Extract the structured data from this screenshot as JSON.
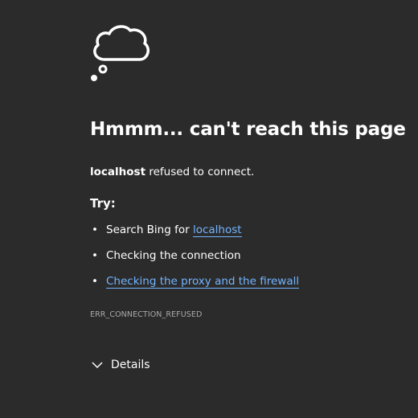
{
  "error_page": {
    "heading": "Hmmm... can't reach this page",
    "message_host": "localhost",
    "message_text": " refused to connect.",
    "try_label": "Try:",
    "suggestions": [
      {
        "prefix": "Search Bing for ",
        "link": "localhost"
      },
      {
        "text": "Checking the connection"
      },
      {
        "link": "Checking the proxy and the firewall"
      }
    ],
    "bullet": "•",
    "error_code": "ERR_CONNECTION_REFUSED",
    "details_label": "Details"
  },
  "icons": {
    "status": "thought-cloud-icon",
    "details": "chevron-down-icon"
  },
  "colors": {
    "background": "#2b2b2b",
    "text": "#ffffff",
    "link": "#73b4ff",
    "muted": "#a9a9a9"
  }
}
